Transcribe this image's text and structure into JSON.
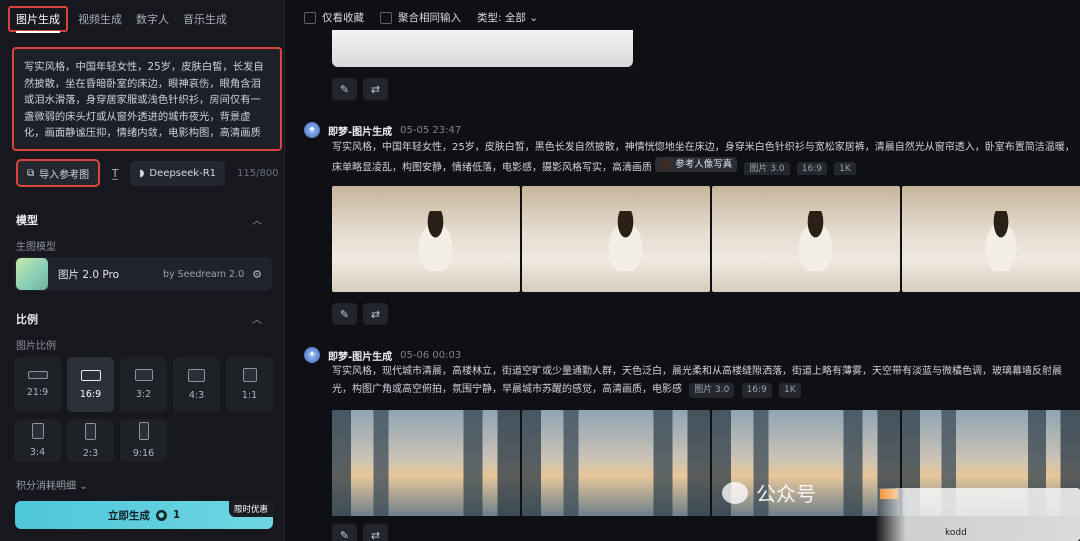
{
  "tabs": [
    "图片生成",
    "视频生成",
    "数字人",
    "音乐生成"
  ],
  "prompt": "写实风格，中国年轻女性，25岁，皮肤白皙，长发自然披散，坐在昏暗卧室的床边，眼神哀伤，眼角含泪或泪水滑落，身穿居家服或浅色针织衫，房间仅有一盏微弱的床头灯或从窗外透进的城市夜光，背景虚化，画面静谧压抑，情绪内敛，电影构图，高清画质",
  "tools": {
    "ref_image_label": "导入参考图",
    "deepseek_label": "Deepseek-R1",
    "char_count": "115/800"
  },
  "model": {
    "section_title": "模型",
    "sub_label": "生图模型",
    "name": "图片 2.0 Pro",
    "by": "by Seedream 2.0"
  },
  "ratio": {
    "section_title": "比例",
    "sub_label": "图片比例",
    "options": [
      "21:9",
      "16:9",
      "3:2",
      "4:3",
      "1:1",
      "3:4",
      "2:3",
      "9:16"
    ],
    "selected": "16:9"
  },
  "points_label": "积分消耗明细",
  "generate": {
    "label": "立即生成",
    "cost": "1",
    "promo": "限时优惠"
  },
  "filters": {
    "favorites": "仅看收藏",
    "merge": "聚合相同输入",
    "type": "类型: 全部"
  },
  "entries": [
    {
      "name": "即梦-图片生成",
      "date": "05-05",
      "time": "23:47",
      "text": "写实风格，中国年轻女性，25岁，皮肤白皙，黑色长发自然披散，神情恍惚地坐在床边，身穿米白色针织衫与宽松家居裤，清晨自然光从窗帘透入，卧室布置简洁温暖，床单略显凌乱，构图安静，情绪低落，电影感，摄影风格写实，高清画质",
      "ref_tag": "参考人像写真",
      "tags": [
        "图片 3.0",
        "16:9",
        "1K"
      ]
    },
    {
      "name": "即梦-图片生成",
      "date": "05-06",
      "time": "00:03",
      "text": "写实风格，现代城市清晨，高楼林立，街道空旷或少量通勤人群，天色泛白，晨光柔和从高楼缝隙洒落，街道上略有薄雾，天空带有淡蓝与微橘色调，玻璃幕墙反射晨光，构图广角或高空俯拍，氛围宁静，早晨城市苏醒的感觉，高清画质，电影感",
      "tags": [
        "图片 3.0",
        "16:9",
        "1K"
      ]
    }
  ],
  "watermark": {
    "text": "公众号",
    "site": "kodd"
  },
  "colors": {
    "accent": "#4cc7d9",
    "highlight_border": "#d9453c"
  }
}
